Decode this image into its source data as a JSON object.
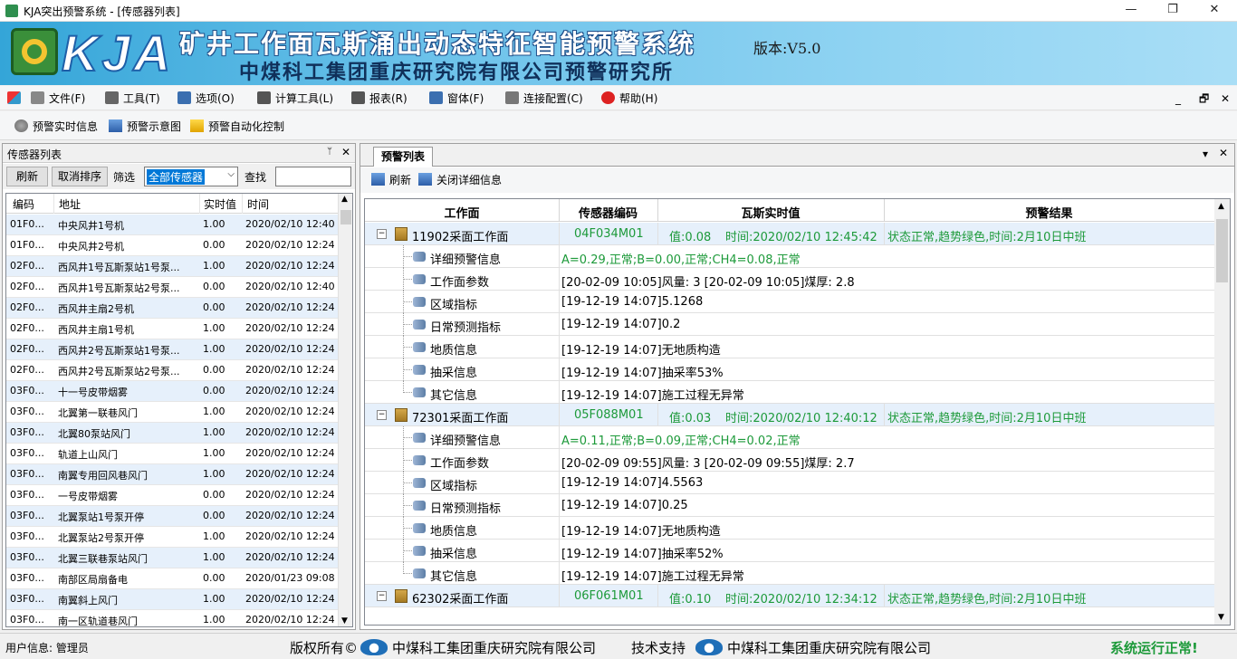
{
  "window": {
    "title": "KJA突出预警系统 - [传感器列表]",
    "min": "—",
    "max": "❐",
    "close": "✕"
  },
  "banner": {
    "logo_text": "KJA",
    "title": "矿井工作面瓦斯涌出动态特征智能预警系统",
    "version": "版本:V5.0",
    "subtitle": "中煤科工集团重庆研究院有限公司预警研究所"
  },
  "menu": [
    {
      "label": "文件(F)",
      "color": "#888"
    },
    {
      "label": "工具(T)",
      "color": "#666"
    },
    {
      "label": "选项(O)",
      "color": "#3b6fb0"
    },
    {
      "label": "计算工具(L)",
      "color": "#555"
    },
    {
      "label": "报表(R)",
      "color": "#555"
    },
    {
      "label": "窗体(F)",
      "color": "#3b6fb0"
    },
    {
      "label": "连接配置(C)",
      "color": "#777"
    },
    {
      "label": "帮助(H)",
      "color": "#d22"
    }
  ],
  "mdi": {
    "min": "_",
    "restore": "🗗",
    "close": "✕"
  },
  "toolbar": [
    {
      "label": "预警实时信息"
    },
    {
      "label": "预警示意图"
    },
    {
      "label": "预警自动化控制"
    }
  ],
  "left": {
    "title": "传感器列表",
    "pin": "📌",
    "close": "✕",
    "refresh": "刷新",
    "cancel_sort": "取消排序",
    "filter_label": "筛选",
    "filter_value": "全部传感器",
    "search_label": "查找",
    "search_value": "",
    "columns": [
      "编码",
      "地址",
      "实时值",
      "时间"
    ],
    "rows": [
      [
        "01F0...",
        "中央风井1号机",
        "1.00",
        "2020/02/10 12:40"
      ],
      [
        "01F0...",
        "中央风井2号机",
        "0.00",
        "2020/02/10 12:24"
      ],
      [
        "02F0...",
        "西风井1号瓦斯泵站1号泵...",
        "1.00",
        "2020/02/10 12:24"
      ],
      [
        "02F0...",
        "西风井1号瓦斯泵站2号泵...",
        "0.00",
        "2020/02/10 12:40"
      ],
      [
        "02F0...",
        "西风井主扇2号机",
        "0.00",
        "2020/02/10 12:24"
      ],
      [
        "02F0...",
        "西风井主扇1号机",
        "1.00",
        "2020/02/10 12:24"
      ],
      [
        "02F0...",
        "西风井2号瓦斯泵站1号泵...",
        "1.00",
        "2020/02/10 12:24"
      ],
      [
        "02F0...",
        "西风井2号瓦斯泵站2号泵...",
        "0.00",
        "2020/02/10 12:24"
      ],
      [
        "03F0...",
        "十一号皮带烟雾",
        "0.00",
        "2020/02/10 12:24"
      ],
      [
        "03F0...",
        "北翼第一联巷风门",
        "1.00",
        "2020/02/10 12:24"
      ],
      [
        "03F0...",
        "北翼80泵站风门",
        "1.00",
        "2020/02/10 12:24"
      ],
      [
        "03F0...",
        "轨道上山风门",
        "1.00",
        "2020/02/10 12:24"
      ],
      [
        "03F0...",
        "南翼专用回风巷风门",
        "1.00",
        "2020/02/10 12:24"
      ],
      [
        "03F0...",
        "一号皮带烟雾",
        "0.00",
        "2020/02/10 12:24"
      ],
      [
        "03F0...",
        "北翼泵站1号泵开停",
        "0.00",
        "2020/02/10 12:24"
      ],
      [
        "03F0...",
        "北翼泵站2号泵开停",
        "1.00",
        "2020/02/10 12:24"
      ],
      [
        "03F0...",
        "北翼三联巷泵站风门",
        "1.00",
        "2020/02/10 12:24"
      ],
      [
        "03F0...",
        "南部区局扇备电",
        "0.00",
        "2020/01/23 09:08"
      ],
      [
        "03F0...",
        "南翼斜上风门",
        "1.00",
        "2020/02/10 12:24"
      ],
      [
        "03F0...",
        "南一区轨道巷风门",
        "1.00",
        "2020/02/10 12:24"
      ]
    ]
  },
  "right": {
    "tab": "预警列表",
    "dropdown": "▾",
    "close": "✕",
    "refresh": "刷新",
    "close_detail": "关闭详细信息",
    "columns": [
      "工作面",
      "传感器编码",
      "瓦斯实时值",
      "预警结果"
    ],
    "groups": [
      {
        "face": "11902采面工作面",
        "code": "04F034M01",
        "value": "值:0.08",
        "time": "时间:2020/02/10 12:45:42",
        "result": "状态正常,趋势绿色,时间:2月10日中班",
        "children": [
          {
            "label": "详细预警信息",
            "detail": "A=0.29,正常;B=0.00,正常;CH4=0.08,正常",
            "green": true
          },
          {
            "label": "工作面参数",
            "detail": "[20-02-09 10:05]风量: 3     [20-02-09 10:05]煤厚: 2.8"
          },
          {
            "label": "区域指标",
            "detail": "[19-12-19 14:07]5.1268"
          },
          {
            "label": "日常预测指标",
            "detail": "[19-12-19 14:07]0.2"
          },
          {
            "label": "地质信息",
            "detail": "[19-12-19 14:07]无地质构造"
          },
          {
            "label": "抽采信息",
            "detail": "[19-12-19 14:07]抽采率53%"
          },
          {
            "label": "其它信息",
            "detail": "[19-12-19 14:07]施工过程无异常"
          }
        ]
      },
      {
        "face": "72301采面工作面",
        "code": "05F088M01",
        "value": "值:0.03",
        "time": "时间:2020/02/10 12:40:12",
        "result": "状态正常,趋势绿色,时间:2月10日中班",
        "children": [
          {
            "label": "详细预警信息",
            "detail": "A=0.11,正常;B=0.09,正常;CH4=0.02,正常",
            "green": true
          },
          {
            "label": "工作面参数",
            "detail": "[20-02-09 09:55]风量: 3     [20-02-09 09:55]煤厚: 2.7"
          },
          {
            "label": "区域指标",
            "detail": "[19-12-19 14:07]4.5563"
          },
          {
            "label": "日常预测指标",
            "detail": "[19-12-19 14:07]0.25"
          },
          {
            "label": "地质信息",
            "detail": "[19-12-19 14:07]无地质构造"
          },
          {
            "label": "抽采信息",
            "detail": "[19-12-19 14:07]抽采率52%"
          },
          {
            "label": "其它信息",
            "detail": "[19-12-19 14:07]施工过程无异常"
          }
        ]
      },
      {
        "face": "62302采面工作面",
        "code": "06F061M01",
        "value": "值:0.10",
        "time": "时间:2020/02/10 12:34:12",
        "result": "状态正常,趋势绿色,时间:2月10日中班",
        "children": []
      }
    ]
  },
  "status": {
    "user": "用户信息: 管理员",
    "copyright": "版权所有©",
    "company": "中煤科工集团重庆研究院有限公司",
    "support": "技术支持",
    "company2": "中煤科工集团重庆研究院有限公司",
    "state": "系统运行正常!",
    "state_color": "#1d9a3a"
  }
}
